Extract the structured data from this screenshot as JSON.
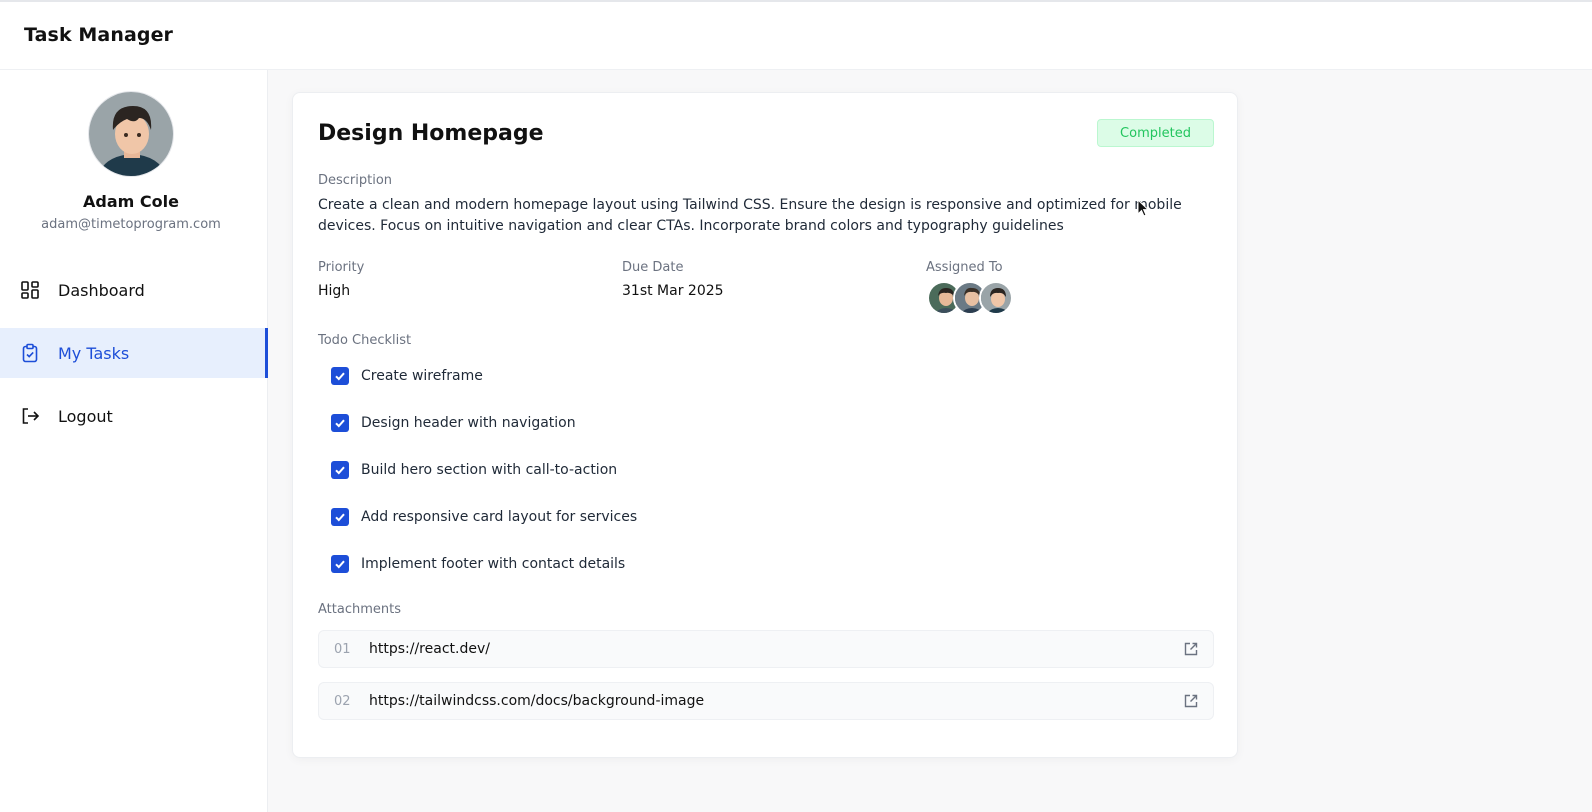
{
  "app": {
    "title": "Task Manager"
  },
  "user": {
    "name": "Adam Cole",
    "email": "adam@timetoprogram.com",
    "avatar_icon": "user-avatar-icon"
  },
  "sidebar": {
    "items": [
      {
        "label": "Dashboard",
        "icon": "dashboard-icon",
        "active": false
      },
      {
        "label": "My Tasks",
        "icon": "clipboard-check-icon",
        "active": true
      },
      {
        "label": "Logout",
        "icon": "logout-icon",
        "active": false
      }
    ]
  },
  "task": {
    "title": "Design Homepage",
    "status": "Completed",
    "description_label": "Description",
    "description": "Create a clean and modern homepage layout using Tailwind CSS. Ensure the design is responsive and optimized for mobile devices. Focus on intuitive navigation and clear CTAs. Incorporate brand colors and typography guidelines",
    "priority_label": "Priority",
    "priority": "High",
    "due_date_label": "Due Date",
    "due_date": "31st Mar 2025",
    "assigned_label": "Assigned To",
    "checklist_label": "Todo Checklist",
    "checklist": [
      {
        "text": "Create wireframe",
        "checked": true
      },
      {
        "text": "Design header with navigation",
        "checked": true
      },
      {
        "text": "Build hero section with call-to-action",
        "checked": true
      },
      {
        "text": "Add responsive card layout for services",
        "checked": true
      },
      {
        "text": "Implement footer with contact details",
        "checked": true
      }
    ],
    "attachments_label": "Attachments",
    "attachments": [
      {
        "num": "01",
        "url": "https://react.dev/"
      },
      {
        "num": "02",
        "url": "https://tailwindcss.com/docs/background-image"
      }
    ]
  },
  "colors": {
    "accent": "#1d4ed8",
    "status_bg": "#dcfce7",
    "status_text": "#22c55e"
  }
}
